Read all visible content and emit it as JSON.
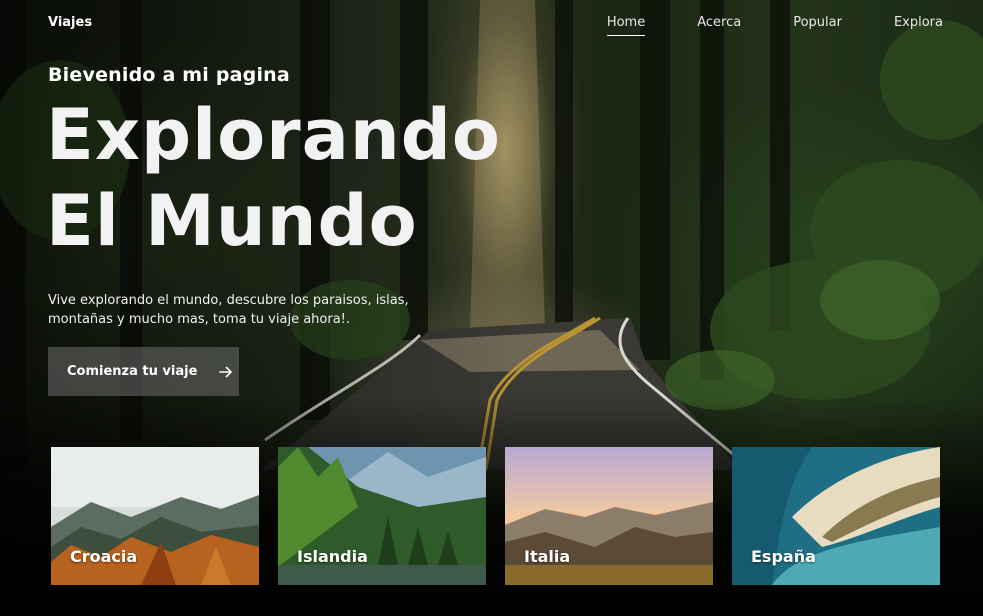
{
  "header": {
    "brand": "Viajes",
    "nav": [
      {
        "label": "Home",
        "active": true
      },
      {
        "label": "Acerca",
        "active": false
      },
      {
        "label": "Popular",
        "active": false
      },
      {
        "label": "Explora",
        "active": false
      }
    ]
  },
  "hero": {
    "subtitle": "Bievenido a mi pagina",
    "title_line1": "Explorando",
    "title_line2": "El Mundo",
    "description": "Vive explorando el mundo, descubre los paraisos, islas, montañas y mucho mas, toma tu viaje ahora!.",
    "cta_label": "Comienza tu viaje",
    "cta_icon": "arrow-right-icon"
  },
  "destinations": [
    {
      "name": "Croacia"
    },
    {
      "name": "Islandia"
    },
    {
      "name": "Italia"
    },
    {
      "name": "España"
    }
  ],
  "colors": {
    "forest_dark": "#141a10",
    "sunbeam": "#ebcd8c",
    "cta_background": "#6e6e6e"
  }
}
